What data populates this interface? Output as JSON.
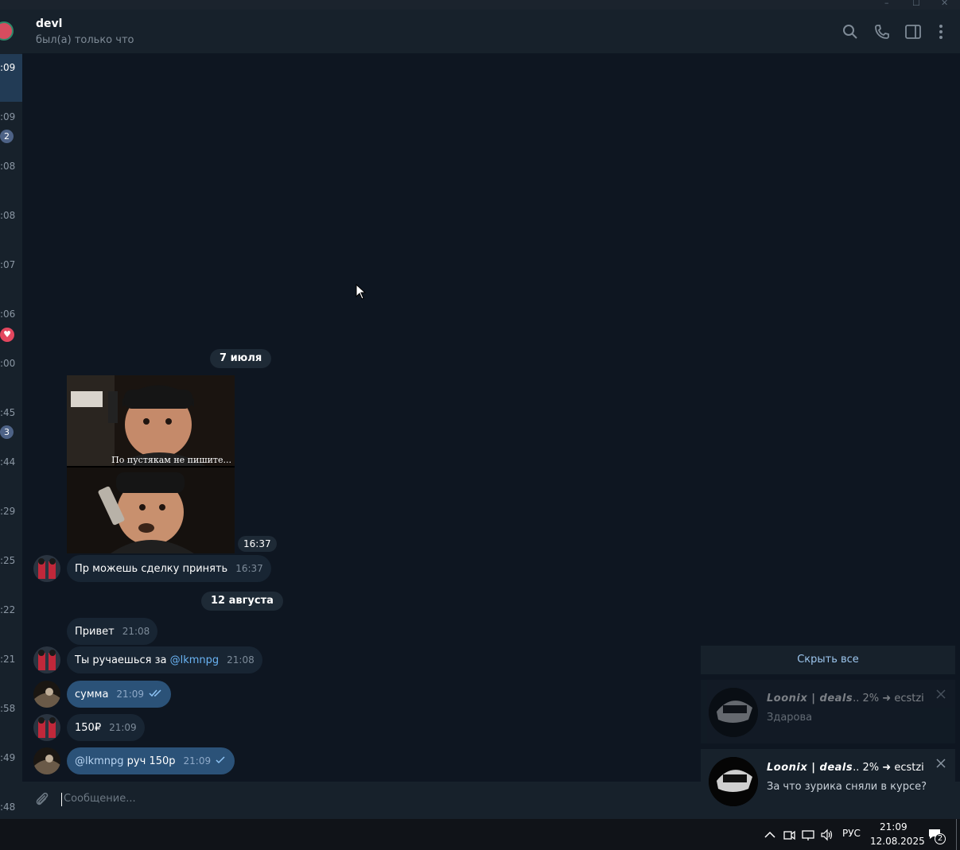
{
  "window": {
    "minimize": "–",
    "maximize": "☐",
    "close": "✕"
  },
  "sidebar": {
    "times": [
      ":09",
      ":09",
      ":08",
      ":08",
      ":07",
      ":06",
      ":00",
      ":45",
      ":44",
      ":29",
      ":25",
      ":22",
      ":21",
      ":58",
      ":49",
      ":48"
    ],
    "badges": [
      "2",
      "3"
    ]
  },
  "header": {
    "name": "devl",
    "status": "был(а) только что"
  },
  "dates": {
    "first": "7 июля",
    "second": "12 августа"
  },
  "messages": {
    "image_caption": "По пустякам не пишите...",
    "image_time": "16:37",
    "m1": {
      "text": "Пр можешь сделку принять",
      "time": "16:37"
    },
    "m2": {
      "text": "Привет",
      "time": "21:08"
    },
    "m3": {
      "text": "Ты ручаешься за ",
      "mention": "@lkmnpg",
      "time": "21:08"
    },
    "m4": {
      "text": "сумма",
      "time": "21:09"
    },
    "m5": {
      "text": "150₽",
      "time": "21:09"
    },
    "m6": {
      "mention": "@lkmnpg",
      "text": " руч 150р",
      "time": "21:09"
    }
  },
  "input": {
    "placeholder": "Сообщение..."
  },
  "notifications": {
    "hide_all": "Скрыть все",
    "items": [
      {
        "title_bold": "Loonix | deals",
        "title_rest": ".. 2% ➜ ecstzi",
        "text": "Здарова"
      },
      {
        "title_bold": "Loonix | deals",
        "title_rest": ".. 2% ➜ ecstzi",
        "text": "За что зурика сняли в курсе?"
      }
    ]
  },
  "taskbar": {
    "lang": "РУС",
    "time": "21:09",
    "date": "12.08.2025",
    "notif_count": "2"
  }
}
